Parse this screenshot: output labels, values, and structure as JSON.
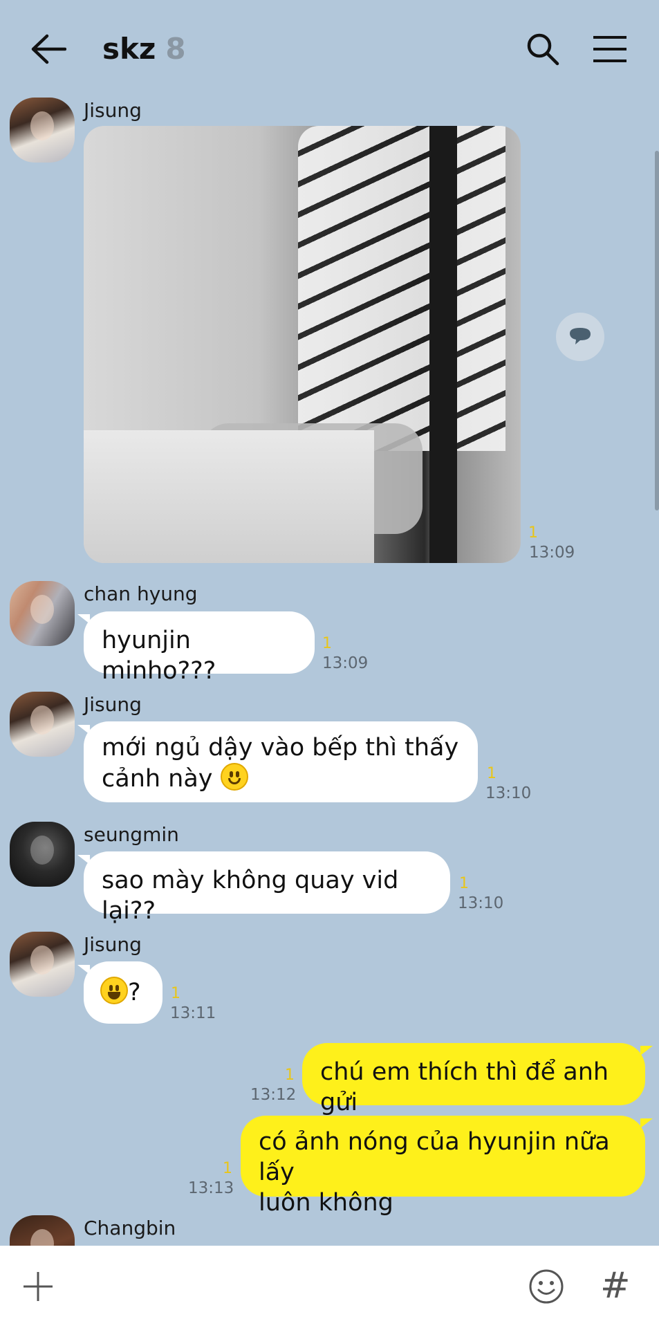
{
  "header": {
    "title": "skz",
    "member_count": "8",
    "back_icon": "arrow-left-icon",
    "search_icon": "search-icon",
    "menu_icon": "hamburger-menu-icon"
  },
  "messages": [
    {
      "sender": "Jisung",
      "type": "image",
      "unread": "1",
      "time": "13:09"
    },
    {
      "sender": "chan hyung",
      "text": "hyunjin minho???",
      "unread": "1",
      "time": "13:09"
    },
    {
      "sender": "Jisung",
      "text_line1": "mới ngủ dậy vào bếp thì thấy",
      "text_line2": "cảnh này",
      "emoji": "slightly-smiling-face",
      "unread": "1",
      "time": "13:10"
    },
    {
      "sender": "seungmin",
      "text": "sao mày không quay vid lại??",
      "unread": "1",
      "time": "13:10"
    },
    {
      "sender": "Jisung",
      "emoji": "grinning-face",
      "text": "?",
      "unread": "1",
      "time": "13:11"
    },
    {
      "sender": "me",
      "text": "chú em thích thì để anh gửi",
      "unread": "1",
      "time": "13:12"
    },
    {
      "sender": "me",
      "text_line1": "có ảnh nóng của hyunjin nữa lấy",
      "text_line2": "luôn không",
      "unread": "1",
      "time": "13:13"
    },
    {
      "sender": "Changbin"
    }
  ],
  "footer": {
    "attach_icon": "plus-icon",
    "emoticon_icon": "smile-icon",
    "hashtag_label": "#"
  },
  "colors": {
    "background": "#b2c7da",
    "my_bubble": "#fef01b",
    "other_bubble": "#ffffff",
    "unread": "#e8c51a"
  }
}
